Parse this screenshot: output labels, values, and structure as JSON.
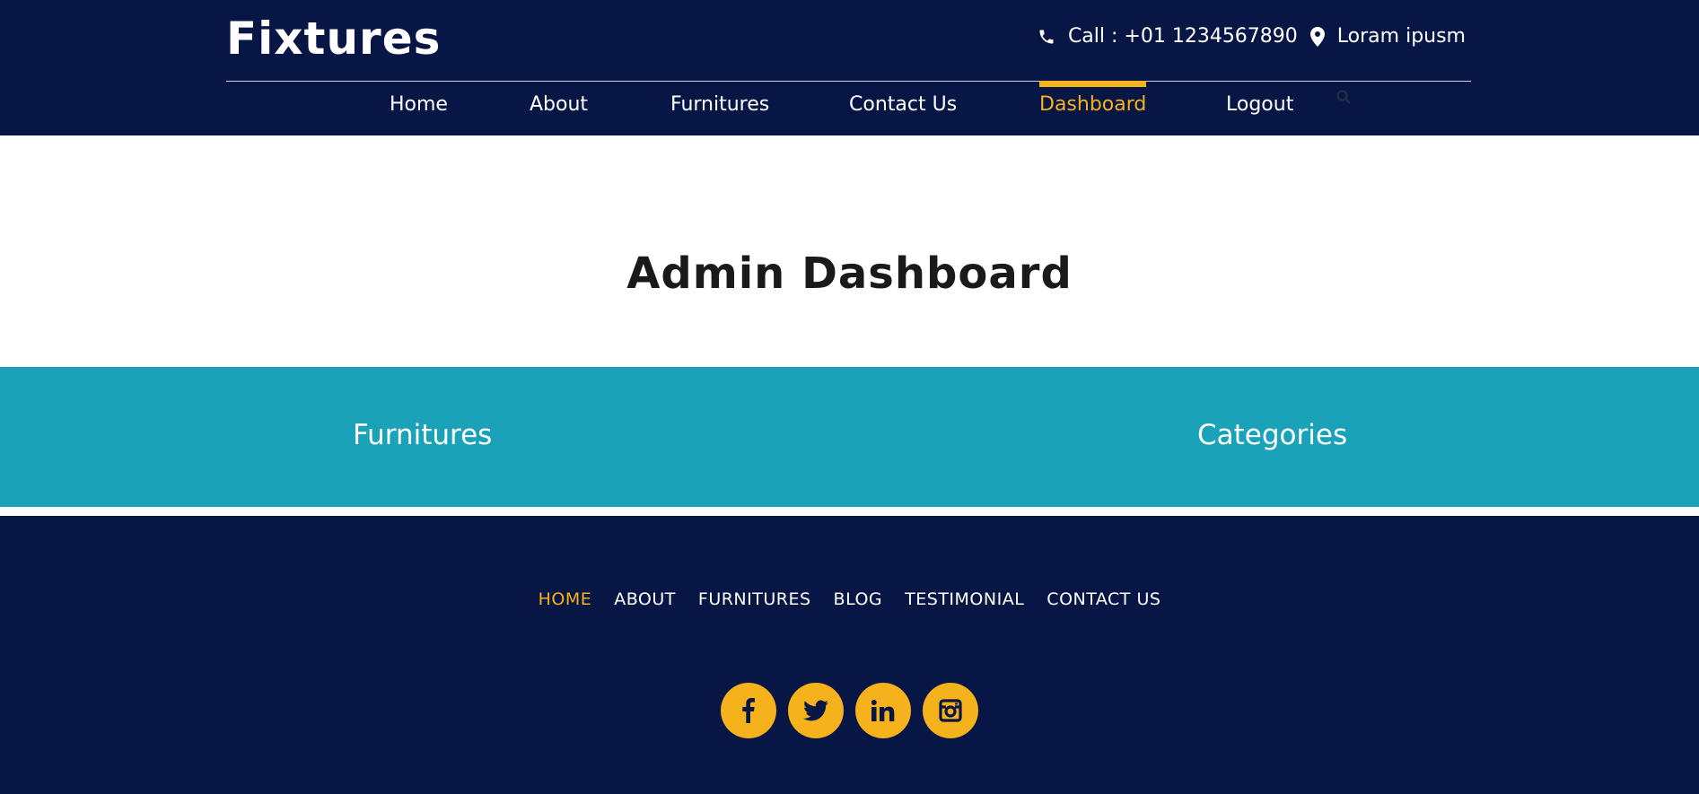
{
  "brand": {
    "logo_text": "Fixtures"
  },
  "contact": {
    "phone_icon": "phone-icon",
    "phone_text": "Call : +01 1234567890",
    "location_icon": "map-marker-icon",
    "location_text": "Loram ipusm"
  },
  "nav": {
    "items": [
      {
        "label": "Home"
      },
      {
        "label": "About"
      },
      {
        "label": "Furnitures"
      },
      {
        "label": "Contact Us"
      },
      {
        "label": "Dashboard",
        "active": true
      },
      {
        "label": "Logout"
      }
    ],
    "search_icon": "search-icon"
  },
  "hero": {
    "title": "Admin Dashboard"
  },
  "admin_links": [
    {
      "label": "Furnitures"
    },
    {
      "label": "Categories"
    }
  ],
  "footer": {
    "nav": [
      {
        "label": "HOME",
        "active": true
      },
      {
        "label": "ABOUT"
      },
      {
        "label": "FURNITURES"
      },
      {
        "label": "BLOG"
      },
      {
        "label": "TESTIMONIAL"
      },
      {
        "label": "CONTACT US"
      }
    ],
    "social": [
      {
        "icon": "facebook-icon"
      },
      {
        "icon": "twitter-icon"
      },
      {
        "icon": "linkedin-icon"
      },
      {
        "icon": "instagram-icon"
      }
    ]
  },
  "colors": {
    "navy": "#081646",
    "accent": "#f5b21c",
    "teal": "#1aa2b8",
    "white": "#ffffff"
  }
}
